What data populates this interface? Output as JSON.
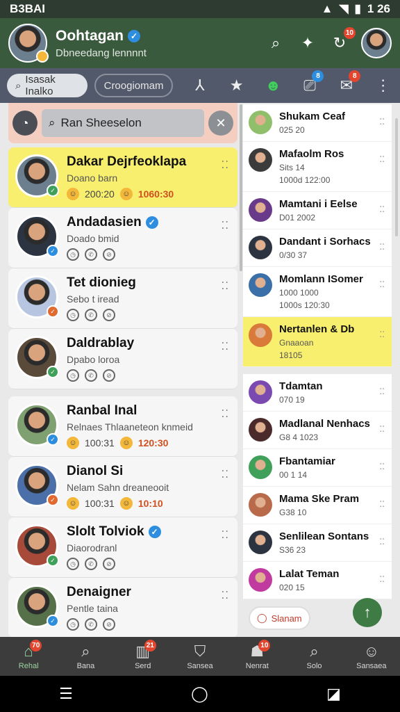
{
  "status": {
    "left": "B3BAI",
    "right": "1 26"
  },
  "header": {
    "title": "Oohtagan",
    "subtitle": "Dbneedang lennnnt",
    "badge": "10"
  },
  "tabs": [
    {
      "label": "Isasak Inalko"
    },
    {
      "label": "Croogiomam"
    }
  ],
  "tab_badges": {
    "t5": "8",
    "t6": "8"
  },
  "search": {
    "placeholder": "Ran Sheeselon"
  },
  "chats": [
    {
      "name": "Dakar Dejrfeoklapa",
      "sub": "Doano barn",
      "meta1": "200:20",
      "meta2": "1060:30",
      "hl": true
    },
    {
      "name": "Andadasien",
      "sub": "Doado bmid",
      "hl": false
    },
    {
      "name": "Tet dionieg",
      "sub": "Sebo t iread",
      "hl": false
    },
    {
      "name": "Daldrablay",
      "sub": "Dpabo loroa",
      "hl": false
    },
    {
      "name": "Ranbal Inal",
      "sub": "Relnaes Thlaaneteon knmeid",
      "meta1": "100:31",
      "meta2": "120:30",
      "hl": false
    },
    {
      "name": "Dianol Si",
      "sub": "Nelam Sahn dreaneooit",
      "meta1": "100:31",
      "meta2": "10:10",
      "hl": false
    },
    {
      "name": "Slolt Tolviok",
      "sub": "Diaorodranl",
      "hl": false
    },
    {
      "name": "Denaigner",
      "sub": "Pentle taina",
      "hl": false
    }
  ],
  "right_chats": [
    {
      "name": "Shukam Ceaf",
      "sub": "025 20",
      "hl": false
    },
    {
      "name": "Mafaolm Ros",
      "sub": "Sits 14",
      "meta": "1000d  122:00",
      "hl": false
    },
    {
      "name": "Mamtani i Eelse",
      "sub": "D01 2002",
      "hl": false
    },
    {
      "name": "Dandant i Sorhacs",
      "sub": "0/30 37",
      "hl": false
    },
    {
      "name": "Momlann ISomer",
      "sub": "1000 1000",
      "meta": "1000s  120:30",
      "hl": false
    },
    {
      "name": "Nertanlen & Db",
      "sub": "Gnaaoan",
      "meta": "18105",
      "hl": true
    },
    {
      "name": "Tdamtan",
      "sub": "070 19",
      "hl": false
    },
    {
      "name": "Madlanal Nenhacs",
      "sub": "G8 4 1023",
      "hl": false
    },
    {
      "name": "Fbantamiar",
      "sub": "00 1 14",
      "hl": false
    },
    {
      "name": "Mama Ske Pram",
      "sub": "G38 10",
      "hl": false
    },
    {
      "name": "Senlilean Sontans",
      "sub": "S36 23",
      "hl": false
    },
    {
      "name": "Lalat Teman",
      "sub": "020 15",
      "hl": false
    }
  ],
  "pill": {
    "label": "Slanam"
  },
  "bottom_nav": [
    {
      "label": "Rehal"
    },
    {
      "label": "Bana"
    },
    {
      "label": "Serd"
    },
    {
      "label": "Sansea"
    },
    {
      "label": "Nenrat"
    },
    {
      "label": "Solo"
    },
    {
      "label": "Sansaea"
    }
  ],
  "bottom_badges": {
    "b0": "70",
    "b2": "21",
    "b4": "10"
  },
  "colors": {
    "header": "#3a5a3e",
    "highlight": "#f8ef6f",
    "accent": "#3f7c45"
  }
}
